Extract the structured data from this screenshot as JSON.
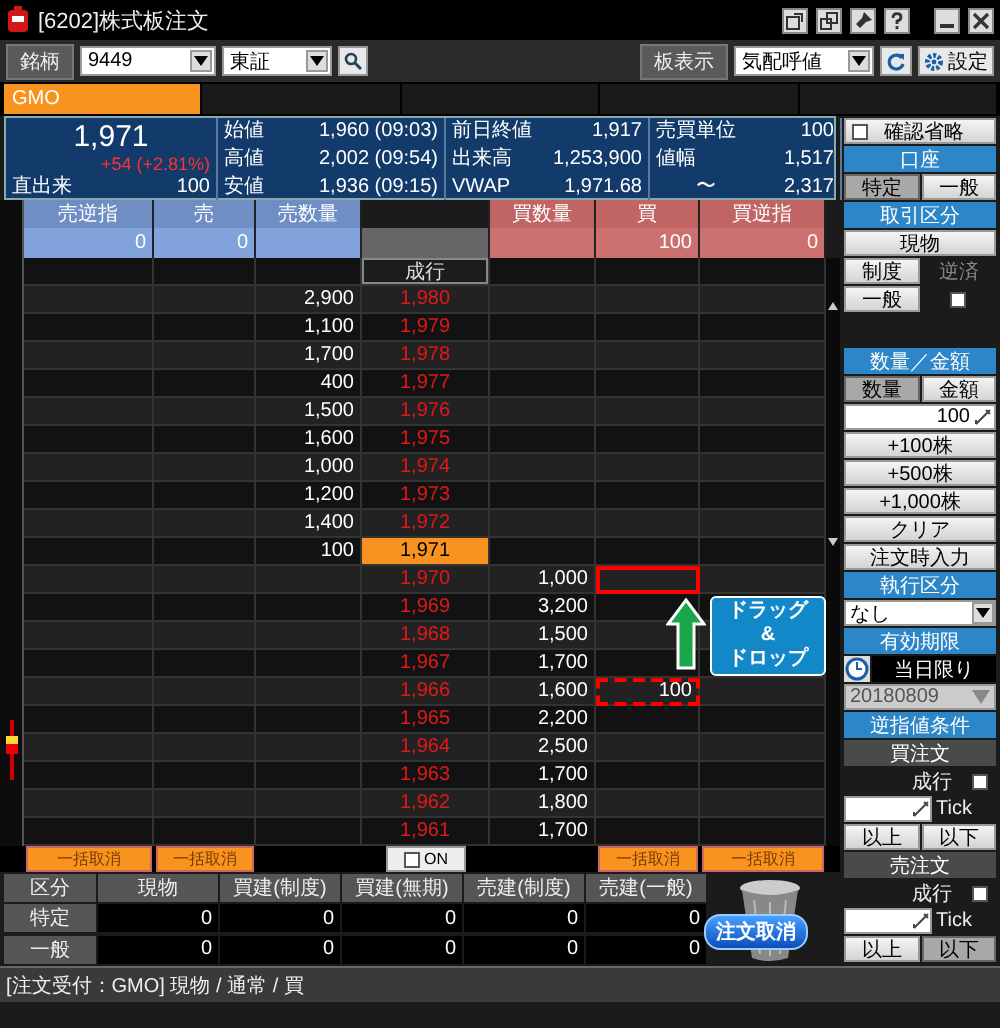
{
  "window": {
    "title": "[6202]株式板注文"
  },
  "toolbar": {
    "symbol_label": "銘柄",
    "symbol": "9449",
    "market": "東証",
    "board_label": "板表示",
    "board_mode": "気配呼値",
    "settings_button": "設定"
  },
  "brokers": [
    {
      "label": "GMO",
      "selected": true
    }
  ],
  "quote": {
    "price": "1,971",
    "change": "+54 (+2.81%)",
    "last_volume_label": "直出来",
    "last_volume": "100",
    "stats": [
      {
        "label": "始値",
        "value": "1,960 (09:03)"
      },
      {
        "label": "高値",
        "value": "2,002 (09:54)"
      },
      {
        "label": "安値",
        "value": "1,936 (09:15)"
      },
      {
        "label": "前日終値",
        "value": "1,917"
      },
      {
        "label": "出来高",
        "value": "1,253,900"
      },
      {
        "label": "VWAP",
        "value": "1,971.68"
      },
      {
        "label": "売買単位",
        "value": "100"
      },
      {
        "label": "値幅",
        "value": "1,517",
        "range_separator": "〜",
        "range_to": "2,317"
      }
    ]
  },
  "board": {
    "sell_columns": [
      "売逆指",
      "売",
      "売数量"
    ],
    "buy_columns": [
      "買数量",
      "買",
      "買逆指"
    ],
    "totals": {
      "sell_stop": "0",
      "sell": "0",
      "buy": "100",
      "buy_stop": "0"
    },
    "rows": [
      {
        "kind": "market",
        "price": "成行"
      },
      {
        "kind": "level",
        "price": "1,980",
        "sell_qty": "2,900"
      },
      {
        "kind": "level",
        "price": "1,979",
        "sell_qty": "1,100"
      },
      {
        "kind": "level",
        "price": "1,978",
        "sell_qty": "1,700"
      },
      {
        "kind": "level",
        "price": "1,977",
        "sell_qty": "400"
      },
      {
        "kind": "level",
        "price": "1,976",
        "sell_qty": "1,500"
      },
      {
        "kind": "level",
        "price": "1,975",
        "sell_qty": "1,600"
      },
      {
        "kind": "level",
        "price": "1,974",
        "sell_qty": "1,000"
      },
      {
        "kind": "level",
        "price": "1,973",
        "sell_qty": "1,200"
      },
      {
        "kind": "level",
        "price": "1,972",
        "sell_qty": "1,400"
      },
      {
        "kind": "current",
        "price": "1,971",
        "sell_qty": "100"
      },
      {
        "kind": "level",
        "price": "1,970",
        "buy_qty": "1,000",
        "drop_target": true
      },
      {
        "kind": "level",
        "price": "1,969",
        "buy_qty": "3,200"
      },
      {
        "kind": "level",
        "price": "1,968",
        "buy_qty": "1,500"
      },
      {
        "kind": "level",
        "price": "1,967",
        "buy_qty": "1,700"
      },
      {
        "kind": "level",
        "price": "1,966",
        "buy_qty": "1,600",
        "buy": "100",
        "drag_source": true
      },
      {
        "kind": "level",
        "price": "1,965",
        "buy_qty": "2,200"
      },
      {
        "kind": "level",
        "price": "1,964",
        "buy_qty": "2,500"
      },
      {
        "kind": "level",
        "price": "1,963",
        "buy_qty": "1,700"
      },
      {
        "kind": "level",
        "price": "1,962",
        "buy_qty": "1,800"
      },
      {
        "kind": "level",
        "price": "1,961",
        "buy_qty": "1,700"
      }
    ],
    "drag_hint": "ドラッグ\n&\nドロップ"
  },
  "cancel_row": {
    "sell": [
      {
        "label": "一括取消",
        "disabled": true
      },
      {
        "label": "一括取消",
        "disabled": true
      }
    ],
    "toggle": {
      "label": "ON",
      "checked": false
    },
    "buy": [
      {
        "label": "一括取消",
        "disabled": true
      },
      {
        "label": "一括取消",
        "disabled": true
      }
    ]
  },
  "side_panel": [
    {
      "kind": "checkbox",
      "label": "確認省略",
      "checked": false
    },
    {
      "kind": "header",
      "label": "口座"
    },
    {
      "kind": "toggle",
      "options": [
        {
          "label": "特定",
          "selected": true
        },
        {
          "label": "一般",
          "selected": false
        }
      ]
    },
    {
      "kind": "header",
      "label": "取引区分"
    },
    {
      "kind": "button",
      "label": "現物"
    },
    {
      "kind": "stack",
      "buttons": [
        "制度",
        "一般"
      ],
      "check_label": "逆済",
      "disabled": true,
      "checked": false
    },
    {
      "kind": "header",
      "label": "数量／金額"
    },
    {
      "kind": "toggle",
      "options": [
        {
          "label": "数量",
          "selected": true
        },
        {
          "label": "金額",
          "selected": false
        }
      ]
    },
    {
      "kind": "input",
      "value": "100"
    },
    {
      "kind": "button",
      "label": "+100株"
    },
    {
      "kind": "button",
      "label": "+500株"
    },
    {
      "kind": "button",
      "label": "+1,000株"
    },
    {
      "kind": "button",
      "label": "クリア"
    },
    {
      "kind": "button",
      "label": "注文時入力"
    },
    {
      "kind": "header",
      "label": "執行区分"
    },
    {
      "kind": "select",
      "value": "なし"
    },
    {
      "kind": "header",
      "label": "有効期限"
    },
    {
      "kind": "expiry",
      "value": "当日限り"
    },
    {
      "kind": "date",
      "value": "20180809",
      "disabled": true
    },
    {
      "kind": "header",
      "label": "逆指値条件"
    },
    {
      "kind": "subheader",
      "label": "買注文"
    },
    {
      "kind": "market_check",
      "label": "成行",
      "checked": false
    },
    {
      "kind": "tick_input",
      "label": "Tick"
    },
    {
      "kind": "toggle",
      "options": [
        {
          "label": "以上",
          "selected": false
        },
        {
          "label": "以下",
          "selected": false
        }
      ]
    },
    {
      "kind": "subheader",
      "label": "売注文"
    },
    {
      "kind": "market_check",
      "label": "成行",
      "checked": false
    },
    {
      "kind": "tick_input",
      "label": "Tick"
    },
    {
      "kind": "toggle",
      "options": [
        {
          "label": "以上",
          "selected": false
        },
        {
          "label": "以下",
          "selected": true
        }
      ]
    }
  ],
  "positions": {
    "columns": [
      "区分",
      "現物",
      "買建(制度)",
      "買建(無期)",
      "売建(制度)",
      "売建(一般)"
    ],
    "rows": [
      {
        "label": "特定",
        "values": [
          "0",
          "0",
          "0",
          "0",
          "0"
        ]
      },
      {
        "label": "一般",
        "values": [
          "0",
          "0",
          "0",
          "0",
          "0"
        ]
      }
    ]
  },
  "cancel_order_button": "注文取消",
  "status_bar": "[注文受付：GMO] 現物 / 通常 / 買"
}
